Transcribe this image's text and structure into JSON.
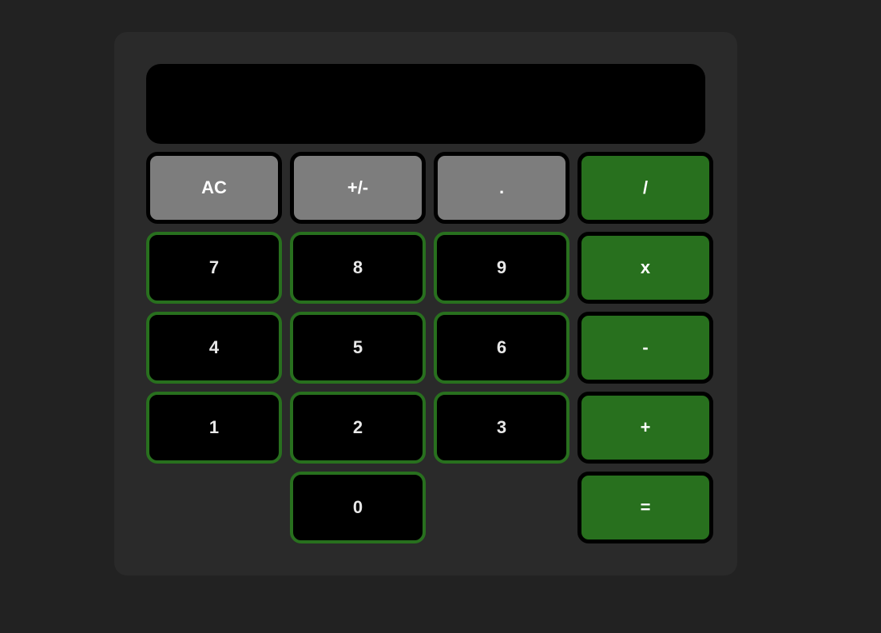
{
  "display": {
    "value": ""
  },
  "keys": {
    "clear": "AC",
    "negate": "+/-",
    "decimal": ".",
    "divide": "/",
    "seven": "7",
    "eight": "8",
    "nine": "9",
    "multiply": "x",
    "four": "4",
    "five": "5",
    "six": "6",
    "subtract": "-",
    "one": "1",
    "two": "2",
    "three": "3",
    "add": "+",
    "zero": "0",
    "equals": "="
  },
  "colors": {
    "page_background": "#222222",
    "panel_background": "#2a2a2a",
    "display_background": "#000000",
    "function_key": "#7d7d7d",
    "operator_key": "#28701e",
    "digit_key_border": "#28701e"
  }
}
